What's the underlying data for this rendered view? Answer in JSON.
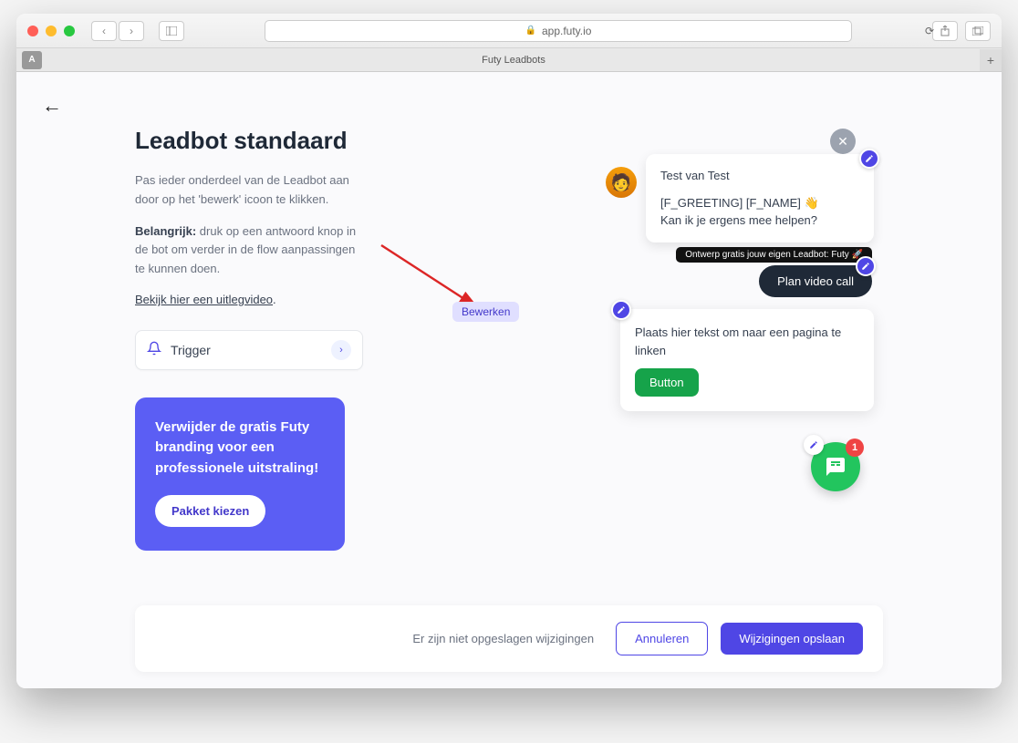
{
  "browser": {
    "url": "app.futy.io",
    "tab_title": "Futy Leadbots",
    "tab_icon": "A"
  },
  "page_title": "Leadbot standaard",
  "desc1": "Pas ieder onderdeel van de Leadbot aan door op het 'bewerk' icoon te klikken.",
  "desc2_strong": "Belangrijk:",
  "desc2_rest": " druk op een antwoord knop in de bot om verder in de flow aanpassingen te kunnen doen.",
  "video_link": "Bekijk hier een uitlegvideo",
  "trigger_label": "Trigger",
  "promo": {
    "text": "Verwijder de gratis Futy branding voor een professionele uitstraling!",
    "button": "Pakket kiezen"
  },
  "tooltip": "Bewerken",
  "msg": {
    "title": "Test van Test",
    "line1": "[F_GREETING] [F_NAME] 👋",
    "line2": "Kan ik je ergens mee helpen?"
  },
  "black_pill": "Ontwerp gratis jouw eigen Leadbot: Futy 🚀",
  "plan_btn": "Plan video call",
  "big_card": {
    "text": "Plaats hier tekst om naar een pagina te linken",
    "button": "Button"
  },
  "chat_badge": "1",
  "footer": {
    "msg": "Er zijn niet opgeslagen wijzigingen",
    "cancel": "Annuleren",
    "save": "Wijzigingen opslaan"
  }
}
